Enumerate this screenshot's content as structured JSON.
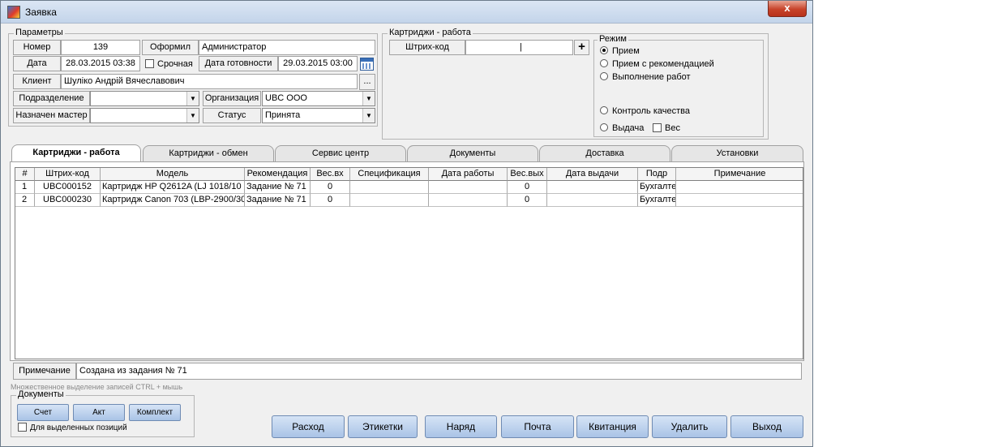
{
  "window": {
    "title": "Заявка",
    "close_label": "x"
  },
  "params": {
    "legend": "Параметры",
    "number_label": "Номер",
    "number_value": "139",
    "author_label": "Оформил",
    "author_value": "Администратор",
    "date_label": "Дата",
    "date_value": "28.03.2015 03:38",
    "urgent_label": "Срочная",
    "ready_label": "Дата готовности",
    "ready_value": "29.03.2015 03:00",
    "client_label": "Клиент",
    "client_value": "Шуліко Андрій Вячеславович",
    "client_more": "...",
    "division_label": "Подразделение",
    "division_value": "",
    "org_label": "Организация",
    "org_value": "UBC ООО",
    "master_label": "Назначен мастер",
    "master_value": "",
    "status_label": "Статус",
    "status_value": "Принята"
  },
  "cartridges": {
    "legend": "Картриджи - работа",
    "barcode_label": "Штрих-код",
    "barcode_value": "|",
    "add_label": "+"
  },
  "mode": {
    "legend": "Режим",
    "options": [
      "Прием",
      "Прием с рекомендацией",
      "Выполнение работ",
      "Контроль качества",
      "Выдача"
    ],
    "selected": "Прием",
    "weight_label": "Вес"
  },
  "tabs": [
    "Картриджи - работа",
    "Картриджи - обмен",
    "Сервис центр",
    "Документы",
    "Доставка",
    "Установки"
  ],
  "active_tab": "Картриджи - работа",
  "table": {
    "columns": [
      "#",
      "Штрих-код",
      "Модель",
      "Рекомендация",
      "Вес.вх",
      "Спецификация",
      "Дата работы",
      "Вес.вых",
      "Дата выдачи",
      "Подр",
      "Примечание"
    ],
    "rows": [
      [
        "1",
        "UBC000152",
        "Картридж HP Q2612A (LJ 1018/10",
        "Задание № 71",
        "0",
        "",
        "",
        "0",
        "",
        "Бухгалте",
        ""
      ],
      [
        "2",
        "UBC000230",
        "Картридж Canon 703 (LBP-2900/30",
        "Задание № 71",
        "0",
        "",
        "",
        "0",
        "",
        "Бухгалте",
        ""
      ]
    ]
  },
  "note": {
    "label": "Примечание",
    "value": "Создана из задания № 71"
  },
  "hint": "Множественное выделение записей CTRL + мышь",
  "documents": {
    "legend": "Документы",
    "buttons": [
      "Счет",
      "Акт",
      "Комплект"
    ],
    "selected_only_label": "Для выделенных позиций"
  },
  "actions": [
    "Расход",
    "Этикетки",
    "Наряд",
    "Почта",
    "Квитанция",
    "Удалить",
    "Выход"
  ]
}
